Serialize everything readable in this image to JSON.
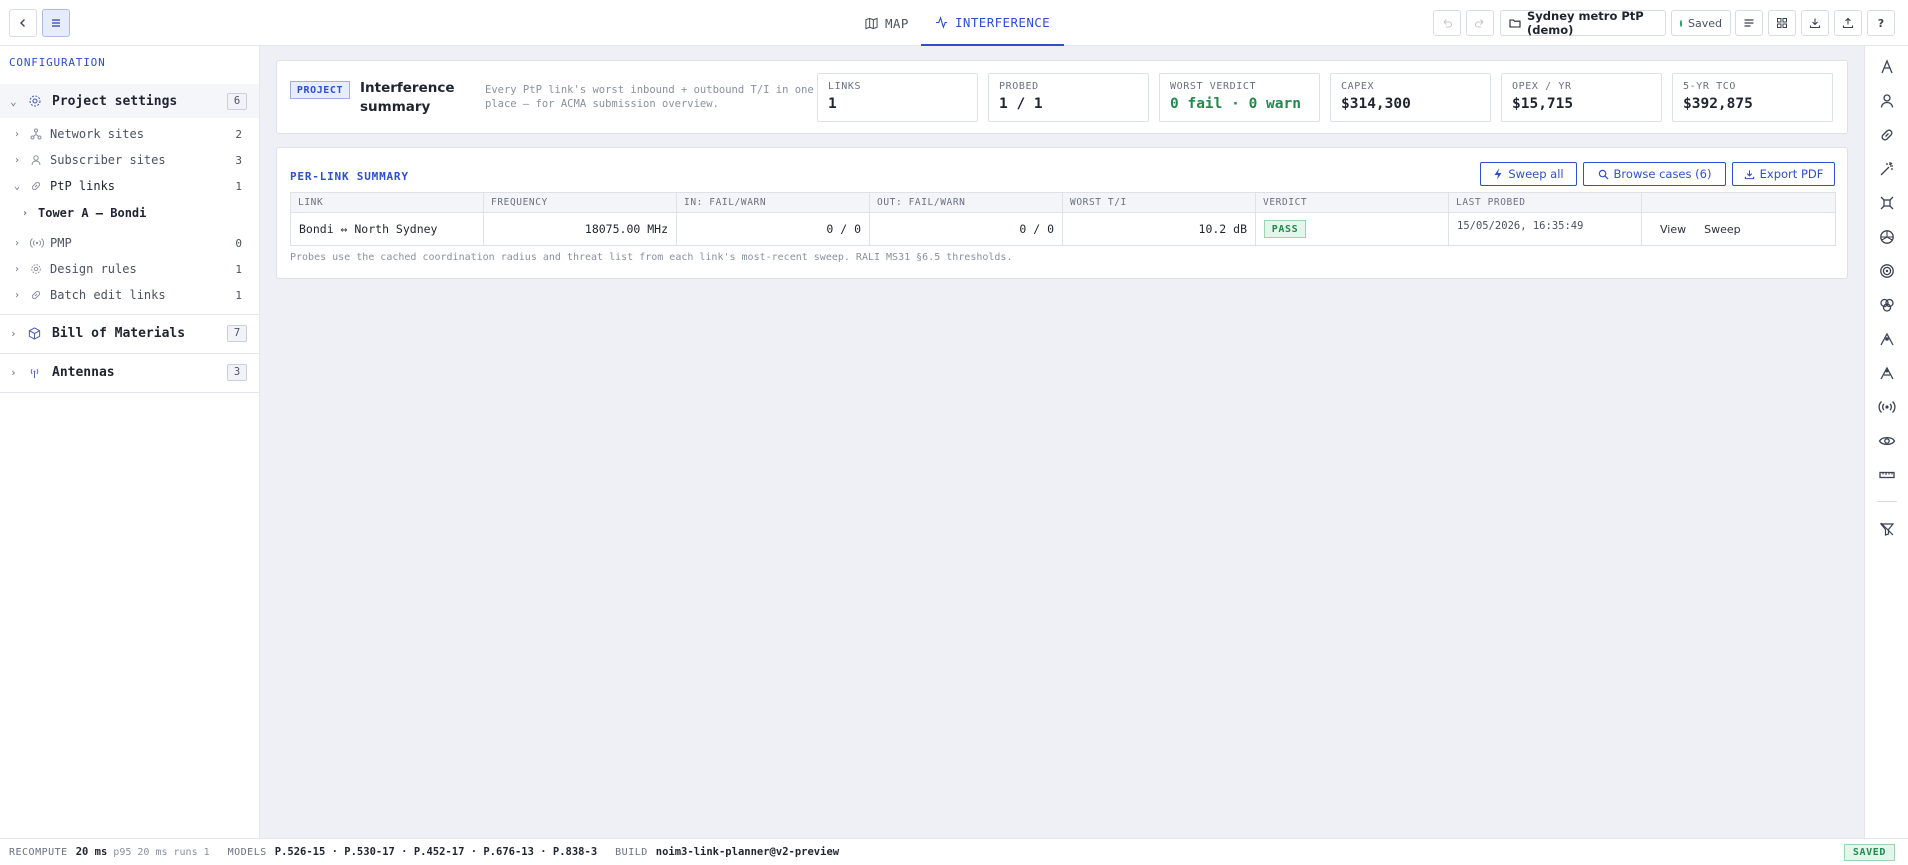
{
  "topbar": {
    "tabs": [
      {
        "label": "MAP",
        "icon": "map-icon"
      },
      {
        "label": "INTERFERENCE",
        "icon": "activity-icon"
      }
    ],
    "project_name": "Sydney metro PtP (demo)",
    "saved_label": "Saved"
  },
  "sidebar": {
    "header": "CONFIGURATION",
    "project_settings": {
      "label": "Project settings",
      "badge": "6"
    },
    "items": [
      {
        "label": "Network sites",
        "count": "2",
        "icon": "network-icon"
      },
      {
        "label": "Subscriber sites",
        "count": "3",
        "icon": "user-icon"
      },
      {
        "label": "PtP links",
        "count": "1",
        "icon": "link-icon"
      },
      {
        "label": "PMP",
        "count": "0",
        "icon": "broadcast-icon"
      },
      {
        "label": "Design rules",
        "count": "1",
        "icon": "gear-icon"
      },
      {
        "label": "Batch edit links",
        "count": "1",
        "icon": "link-icon"
      }
    ],
    "ptp_child": "Tower A — Bondi",
    "bill_of_materials": {
      "label": "Bill of Materials",
      "badge": "7"
    },
    "antennas": {
      "label": "Antennas",
      "badge": "3"
    }
  },
  "project": {
    "tag": "PROJECT",
    "title": "Interference summary",
    "description": "Every PtP link's worst inbound + outbound T/I in one place — for ACMA submission overview.",
    "stats": [
      {
        "key": "LINKS",
        "value": "1"
      },
      {
        "key": "PROBED",
        "value": "1 / 1"
      },
      {
        "key": "WORST VERDICT",
        "value": "0 fail · 0 warn"
      },
      {
        "key": "CAPEX",
        "value": "$314,300"
      },
      {
        "key": "OPEX / YR",
        "value": "$15,715"
      },
      {
        "key": "5-YR TCO",
        "value": "$392,875"
      }
    ]
  },
  "summary": {
    "heading": "PER-LINK SUMMARY",
    "buttons": {
      "sweep_all": "Sweep all",
      "browse_cases": "Browse cases (6)",
      "export_pdf": "Export PDF"
    },
    "columns": [
      "LINK",
      "FREQUENCY",
      "IN: FAIL/WARN",
      "OUT: FAIL/WARN",
      "WORST T/I",
      "VERDICT",
      "LAST PROBED",
      ""
    ],
    "rows": [
      {
        "link": "Bondi ↔ North Sydney",
        "frequency": "18075.00 MHz",
        "in": "0 / 0",
        "out": "0 / 0",
        "worst_ti": "10.2 dB",
        "verdict": "PASS",
        "last_probed": "15/05/2026, 16:35:49",
        "view": "View",
        "sweep": "Sweep"
      }
    ],
    "footnote": "Probes use the cached coordination radius and threat list from each link's most-recent sweep. RALI MS31 §6.5 thresholds."
  },
  "status_bar": {
    "recompute_label": "RECOMPUTE",
    "recompute_value": "20 ms",
    "recompute_detail": "p95 20 ms runs 1",
    "models_label": "MODELS",
    "models_value": "P.526-15 · P.530-17 · P.452-17 · P.676-13 · P.838-3",
    "build_label": "BUILD",
    "build_value": "noim3-link-planner@v2-preview",
    "saved_pill": "SAVED"
  },
  "colors": {
    "accent": "#2d4fd0",
    "pass": "#1f8a4c",
    "background": "#eef0f5"
  }
}
